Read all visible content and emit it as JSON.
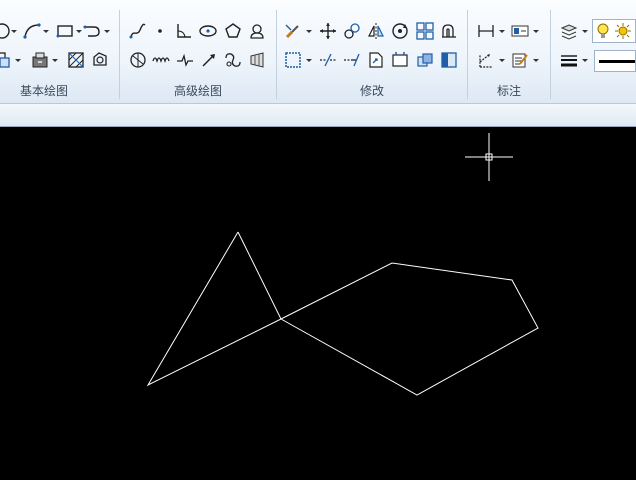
{
  "ribbon": {
    "panels": [
      {
        "id": "draw",
        "title": "基本绘图"
      },
      {
        "id": "advanced-draw",
        "title": "高级绘图"
      },
      {
        "id": "modify",
        "title": "修改"
      },
      {
        "id": "annotation",
        "title": "标注"
      }
    ]
  },
  "colors": {
    "ribbon_bg": "#eef4fb",
    "canvas_bg": "#000000",
    "geometry": "#ffffff",
    "icon_blue": "#1f5fa8"
  },
  "icons": [
    "circle-icon",
    "arc-icon",
    "rectangle-icon",
    "polyline-icon",
    "hatch-icon",
    "insert-block-icon",
    "region-icon",
    "boundary-icon",
    "spline-icon",
    "point-icon",
    "angle-dimension-icon",
    "ellipse-icon",
    "polygon-icon",
    "revcloud-icon",
    "donut-icon",
    "wipeout-icon",
    "arrow-line-icon",
    "helix-icon",
    "table-icon",
    "erase-icon",
    "move-icon",
    "copy-icon",
    "mirror-icon",
    "rotate-icon",
    "array-icon",
    "offset-icon",
    "select-window-icon",
    "trim-icon",
    "extend-icon",
    "stretch-icon",
    "explode-icon",
    "layer-copy-icon",
    "properties-icon",
    "linear-dimension-icon",
    "dimension-style-icon",
    "leader-icon",
    "text-edit-icon",
    "layer-manager-icon",
    "layer-bulb-icon",
    "lineweight-icon"
  ]
}
